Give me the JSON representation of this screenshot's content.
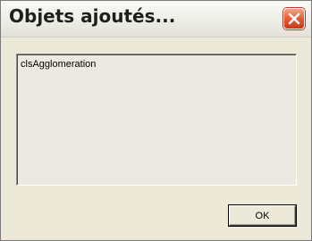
{
  "window": {
    "title": "Objets ajoutés..."
  },
  "titlebar": {
    "close_icon": "close-icon",
    "close_color": "#e45b32"
  },
  "list": {
    "items": [
      "clsAgglomeration"
    ]
  },
  "buttons": {
    "ok_label": "OK"
  }
}
